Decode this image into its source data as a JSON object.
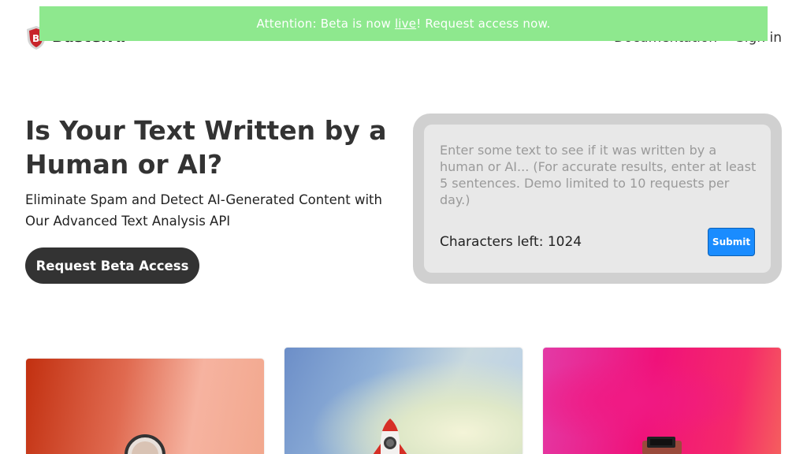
{
  "brand": {
    "name": "BusterAI"
  },
  "nav": {
    "documentation": "Documentation",
    "sign_in": "Sign in"
  },
  "banner": {
    "prefix": "Attention: Beta is now ",
    "link": "live",
    "suffix": "! Request access now."
  },
  "hero": {
    "title": "Is Your Text Written by a Human or AI?",
    "subtitle": "Eliminate Spam and Detect AI-Generated Content with Our Advanced Text Analysis API",
    "cta": "Request Beta Access"
  },
  "demo": {
    "placeholder": "Enter some text to see if it was written by a human or AI... (For accurate results, enter at least 5 sentences. Demo limited to 10 requests per day.)",
    "chars_label": "Characters left: 1024",
    "submit": "Submit"
  },
  "colors": {
    "banner": "#8ee88e",
    "cta": "#333333",
    "submit": "#1a8cff"
  },
  "icons": {
    "logo": "shield-logo-icon"
  }
}
